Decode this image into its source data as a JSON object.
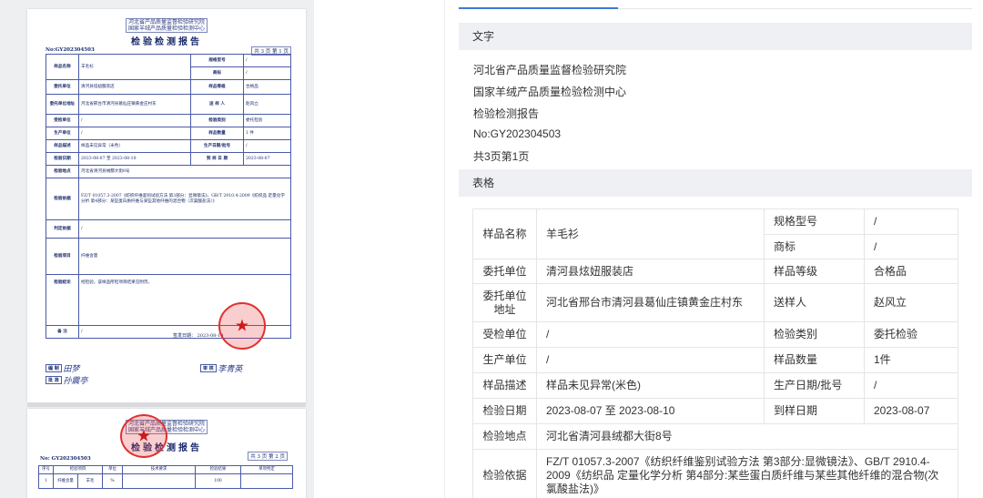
{
  "preview": {
    "page1": {
      "org1": "河北省产品质量监督检验研究院",
      "org2": "国家羊绒产品质量检验检测中心",
      "title": "检验检测报告",
      "report_no": "No:GY202304503",
      "page_info": "共 3 页 第 1 页",
      "rows": [
        {
          "l1": "样品名称",
          "v1": "羊毛衫",
          "l2": "规格型号",
          "v2": "/"
        },
        {
          "l1": "",
          "v1": "",
          "l2": "商标",
          "v2": "/"
        },
        {
          "l1": "委托单位",
          "v1": "清河县炫妞服装店",
          "l2": "样品等级",
          "v2": "合格品"
        },
        {
          "l1": "委托单位地址",
          "v1": "河北省邢台市清河县葛仙庄镇黄金庄村东",
          "l2": "送 样 人",
          "v2": "赵风立"
        },
        {
          "l1": "受检单位",
          "v1": "/",
          "l2": "检验类别",
          "v2": "委托检验"
        },
        {
          "l1": "生产单位",
          "v1": "/",
          "l2": "样品数量",
          "v2": "1 件"
        },
        {
          "l1": "样品描述",
          "v1": "样品未见异常（米色）",
          "l2": "生产日期/批号",
          "v2": "/"
        },
        {
          "l1": "检验日期",
          "v1": "2023-08-07 至 2023-08-10",
          "l2": "到 样 日 期",
          "v2": "2023-08-07"
        }
      ],
      "location_label": "检验地点",
      "location_value": "河北省清河县绒都大街8号",
      "basis_label": "检验依据",
      "basis_value": "FZ/T 01057.3-2007《纺织纤维鉴别试验方法 第3部分：显微镜法》、GB/T 2910.4-2009《纺织品 定量化学分析 第4部分：某些蛋白质纤维与某些其他纤维的混合物（次氯酸盐法）》",
      "judge_label": "判定依据",
      "judge_value": "/",
      "item_label": "检验项目",
      "item_value": "纤维含量",
      "conclusion_label": "检验结论",
      "conclusion_value": "经检验，该样品所检项目结果见附页。",
      "issue_date": "签发日期： 2023-08-10",
      "remark_label": "备 注",
      "remark_value": "/",
      "sig_compile": "编 制",
      "sig_compile_name": "田梦",
      "sig_approve": "批 准",
      "sig_approve_name": "孙震亭",
      "sig_review": "审 核",
      "sig_review_name": "李青英"
    },
    "page2": {
      "org1": "河北省产品质量监督检验研究院",
      "org2": "国家羊绒产品质量检验检测中心",
      "title": "检验检测报告",
      "report_no": "No: GY202304503",
      "page_info": "共 3 页 第 2 页",
      "headers": [
        "序号",
        "检验项目",
        "单位",
        "技术要求",
        "检验结果",
        "单项判定"
      ],
      "row": [
        "1",
        "纤维含量",
        "羊毛",
        "%",
        "",
        "100",
        ""
      ]
    }
  },
  "panel": {
    "text_section": "文字",
    "lines": [
      "河北省产品质量监督检验研究院",
      "国家羊绒产品质量检验检测中心",
      "检验检测报告",
      "No:GY202304503",
      "共3页第1页"
    ],
    "table_section": "表格",
    "table": {
      "r1": {
        "l1": "样品名称",
        "v1": "羊毛衫",
        "l2": "规格型号",
        "v2": "/"
      },
      "r2": {
        "l2": "商标",
        "v2": "/"
      },
      "r3": {
        "l1": "委托单位",
        "v1": "清河县炫妞服装店",
        "l2": "样品等级",
        "v2": "合格品"
      },
      "r4": {
        "l1": "委托单位地址",
        "v1": "河北省邢台市清河县葛仙庄镇黄金庄村东",
        "l2": "送样人",
        "v2": "赵风立"
      },
      "r5": {
        "l1": "受检单位",
        "v1": "/",
        "l2": "检验类别",
        "v2": "委托检验"
      },
      "r6": {
        "l1": "生产单位",
        "v1": "/",
        "l2": "样品数量",
        "v2": "1件"
      },
      "r7": {
        "l1": "样品描述",
        "v1": "样品未见异常(米色)",
        "l2": "生产日期/批号",
        "v2": "/"
      },
      "r8": {
        "l1": "检验日期",
        "v1": "2023-08-07 至 2023-08-10",
        "l2": "到样日期",
        "v2": "2023-08-07"
      },
      "r9": {
        "l1": "检验地点",
        "v1": "河北省清河县绒都大街8号"
      },
      "r10": {
        "l1": "检验依据",
        "v1": "FZ/T 01057.3-2007《纺织纤维鉴别试验方法 第3部分:显微镜法》、GB/T 2910.4-2009《纺织品 定量化学分析 第4部分:某些蛋白质纤维与某些其他纤维的混合物(次氯酸盐法)》"
      }
    }
  },
  "colors": {
    "accent": "#3a7bd5",
    "section_bg": "#eef0f4",
    "stamp": "#e03030"
  }
}
